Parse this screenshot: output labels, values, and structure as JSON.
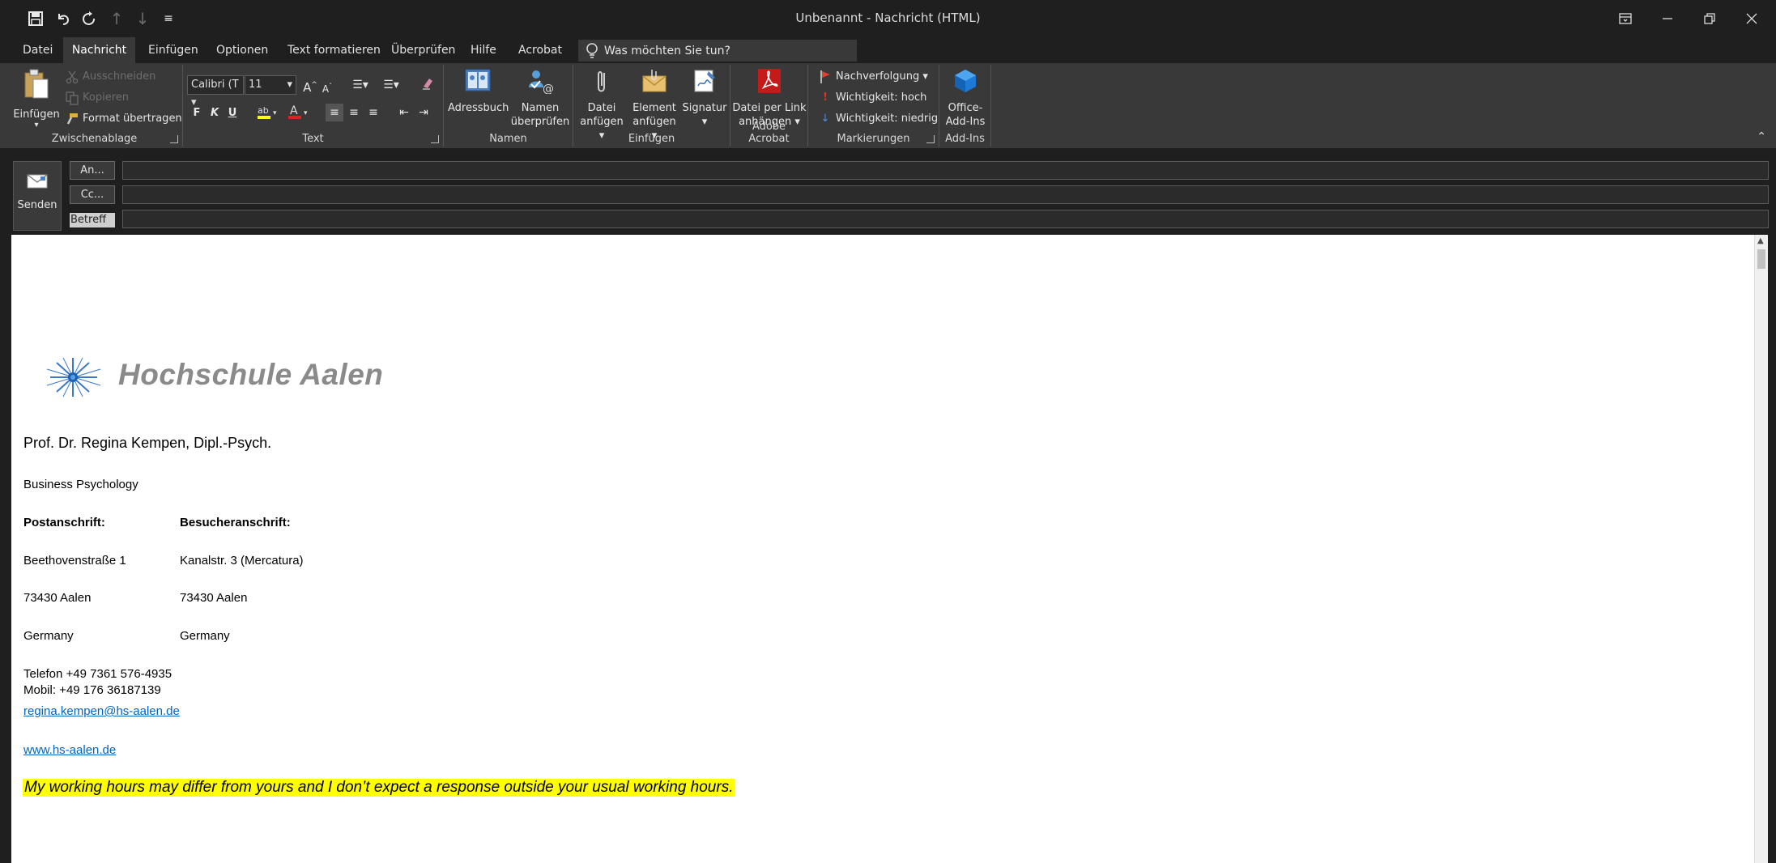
{
  "window": {
    "title": "Unbenannt  -  Nachricht (HTML)"
  },
  "menu": {
    "tabs": [
      "Datei",
      "Nachricht",
      "Einfügen",
      "Optionen",
      "Text formatieren",
      "Überprüfen",
      "Hilfe",
      "Acrobat"
    ],
    "active_tab": "Nachricht",
    "tell_me": "Was möchten Sie tun?"
  },
  "ribbon": {
    "clipboard": {
      "paste": "Einfügen",
      "cut": "Ausschneiden",
      "copy": "Kopieren",
      "format_painter": "Format übertragen",
      "label": "Zwischenablage"
    },
    "text": {
      "font": "Calibri (T",
      "size": "11",
      "bold": "F",
      "italic": "K",
      "underline": "U",
      "label": "Text"
    },
    "names": {
      "address_book": "Adressbuch",
      "check_names_1": "Namen",
      "check_names_2": "überprüfen",
      "label": "Namen"
    },
    "include": {
      "attach_file_1": "Datei",
      "attach_file_2": "anfügen",
      "attach_item_1": "Element",
      "attach_item_2": "anfügen",
      "signature": "Signatur",
      "label": "Einfügen"
    },
    "acrobat": {
      "attach_link_1": "Datei per Link",
      "attach_link_2": "anhängen",
      "label": "Adobe Acrobat"
    },
    "tags": {
      "follow_up": "Nachverfolgung",
      "high": "Wichtigkeit: hoch",
      "low": "Wichtigkeit: niedrig",
      "label": "Markierungen"
    },
    "addins": {
      "office_1": "Office-",
      "office_2": "Add-Ins",
      "label": "Add-Ins"
    }
  },
  "compose": {
    "send": "Senden",
    "to": "An...",
    "cc": "Cc...",
    "subject": "Betreff"
  },
  "signature": {
    "logo_text": "Hochschule Aalen",
    "name": "Prof. Dr. Regina Kempen, Dipl.-Psych.",
    "department": "Business Psychology",
    "postal_heading": "Postanschrift:",
    "visitor_heading": "Besucheranschrift:",
    "postal_street": "Beethovenstraße 1",
    "visitor_street": "Kanalstr. 3 (Mercatura)",
    "postal_city": "73430 Aalen",
    "visitor_city": "73430 Aalen",
    "postal_country": "Germany",
    "visitor_country": "Germany",
    "phone": "Telefon +49 7361 576-4935",
    "mobile": "Mobil: +49 176 36187139",
    "email": "regina.kempen@hs-aalen.de",
    "website": "www.hs-aalen.de",
    "disclaimer": "My working hours may differ from yours and I don’t expect a response outside your usual working hours."
  },
  "colors": {
    "ribbon_bg": "#393939",
    "titlebar_bg": "#1f1f1f",
    "highlight": "#ffff00",
    "link": "#0563c1"
  }
}
